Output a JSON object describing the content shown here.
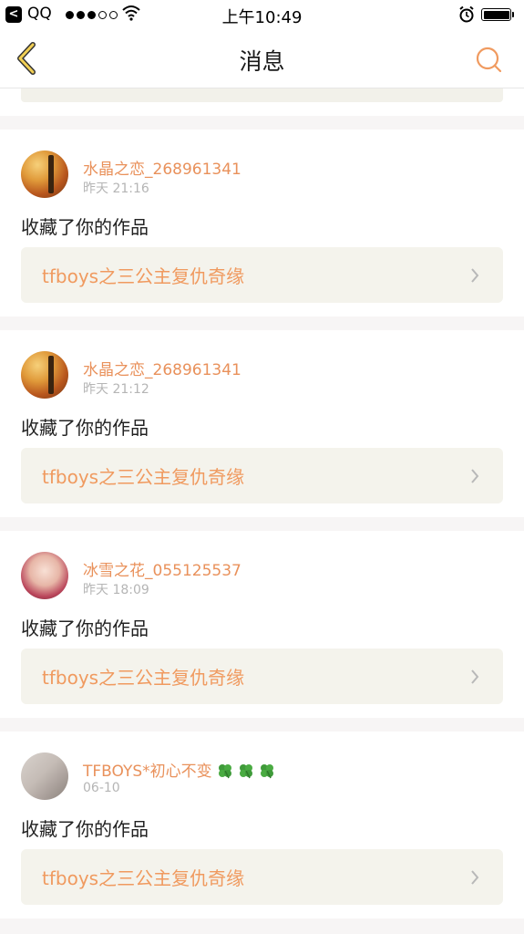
{
  "status_bar": {
    "back_app": "QQ",
    "back_glyph": "<",
    "time": "上午10:49"
  },
  "nav": {
    "title": "消息",
    "back_icon": "chevron-left-icon",
    "search_icon": "search-icon"
  },
  "messages": [
    {
      "user": "水晶之恋_268961341",
      "time": "昨天 21:16",
      "action": "收藏了你的作品",
      "work": "tfboys之三公主复仇奇缘",
      "avatar": "tree-avatar"
    },
    {
      "user": "水晶之恋_268961341",
      "time": "昨天 21:12",
      "action": "收藏了你的作品",
      "work": "tfboys之三公主复仇奇缘",
      "avatar": "tree-avatar"
    },
    {
      "user": "冰雪之花_055125537",
      "time": "昨天 18:09",
      "action": "收藏了你的作品",
      "work": "tfboys之三公主复仇奇缘",
      "avatar": "anime-girl-avatar"
    },
    {
      "user": "TFBOYS*初心不变",
      "time": "06-10",
      "action": "收藏了你的作品",
      "work": "tfboys之三公主复仇奇缘",
      "avatar": "photo-avatar",
      "name_emoji": "four-leaf-clover-icon"
    }
  ],
  "colors": {
    "accent": "#f09a5f",
    "username": "#e9915b",
    "timestamp": "#b5b5b5",
    "card_bg": "#f4f3ec",
    "page_bg": "#f7f5f5"
  }
}
